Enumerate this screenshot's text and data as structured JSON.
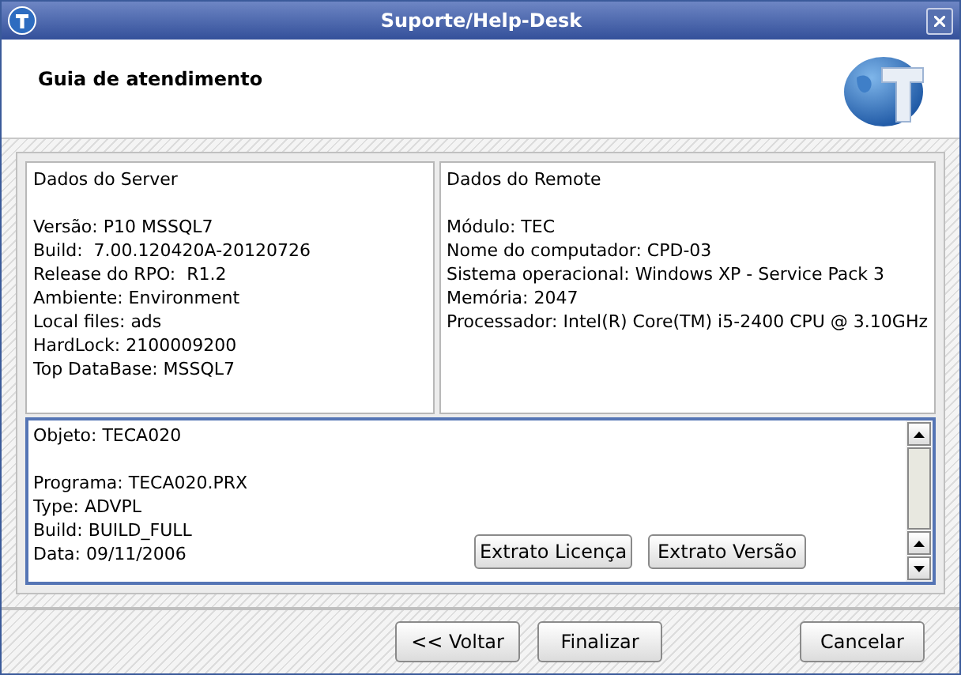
{
  "window": {
    "title": "Suporte/Help-Desk"
  },
  "header": {
    "title": "Guia de atendimento"
  },
  "server_panel": {
    "title": "Dados do Server",
    "lines": [
      "Versão: P10 MSSQL7",
      "Build:  7.00.120420A-20120726",
      "Release do RPO:  R1.2",
      "Ambiente: Environment",
      "Local files: ads",
      "HardLock: 2100009200",
      "Top DataBase: MSSQL7"
    ]
  },
  "remote_panel": {
    "title": "Dados do Remote",
    "lines": [
      "Módulo: TEC",
      "Nome do computador: CPD-03",
      "Sistema operacional: Windows XP - Service Pack 3",
      "Memória: 2047",
      "Processador: Intel(R) Core(TM) i5-2400 CPU @ 3.10GHz"
    ]
  },
  "object_panel": {
    "title": "Objeto: TECA020",
    "lines": [
      "Programa: TECA020.PRX",
      "Type: ADVPL",
      "Build: BUILD_FULL",
      "Data: 09/11/2006"
    ],
    "buttons": [
      "Extrato Licença",
      "Extrato Versão"
    ]
  },
  "footer_buttons": [
    "<< Voltar",
    "Finalizar",
    "Cancelar"
  ]
}
